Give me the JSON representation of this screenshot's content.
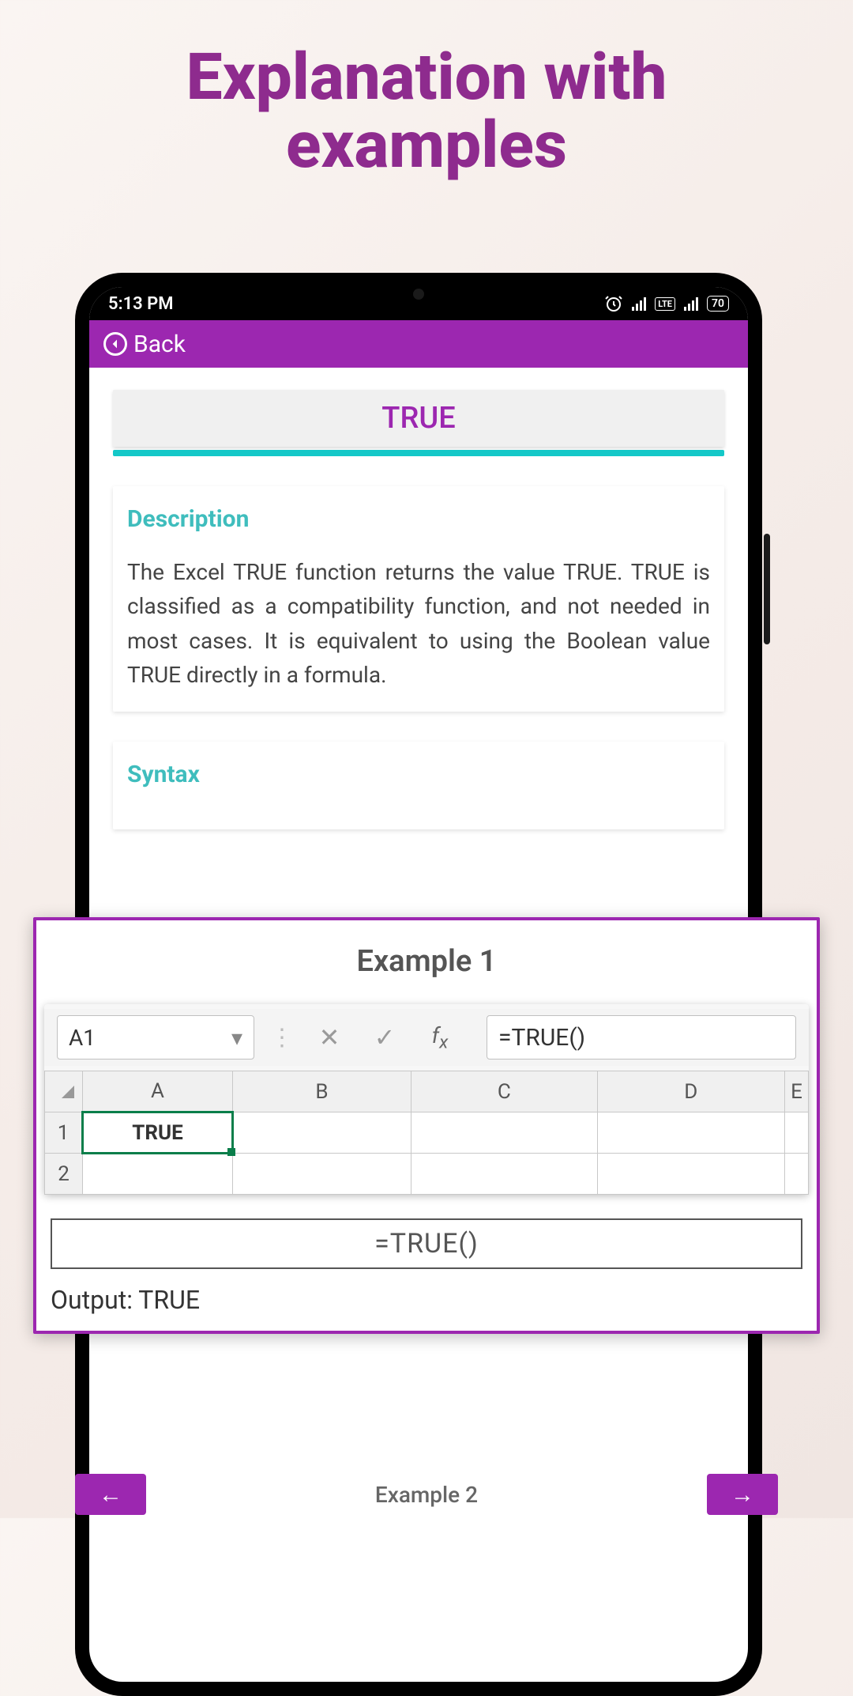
{
  "promo": {
    "line1": "Explanation with",
    "line2": "examples"
  },
  "statusbar": {
    "time": "5:13 PM",
    "battery": "70"
  },
  "header": {
    "back_label": "Back"
  },
  "page": {
    "title": "TRUE",
    "description_label": "Description",
    "description_text": "The Excel TRUE function returns the value TRUE. TRUE is classified as a compatibility function, and not needed in most cases. It is equivalent to using the Boolean value TRUE directly in a formula.",
    "syntax_label": "Syntax"
  },
  "example": {
    "title": "Example 1",
    "cell_ref": "A1",
    "formula_bar_value": "=TRUE()",
    "columns": [
      "A",
      "B",
      "C",
      "D",
      "E"
    ],
    "rows": [
      "1",
      "2"
    ],
    "active_value": "TRUE",
    "formula_display": "=TRUE()",
    "output": "Output: TRUE"
  },
  "bottom": {
    "center_label": "Example 2"
  }
}
